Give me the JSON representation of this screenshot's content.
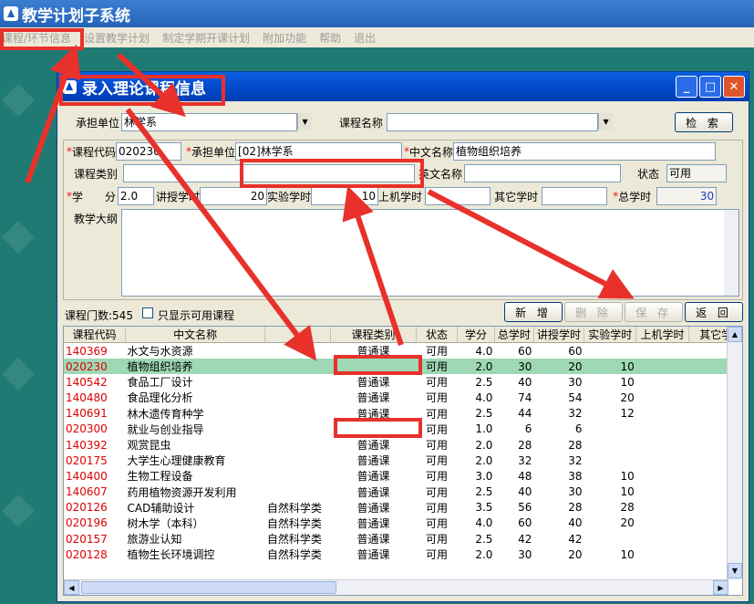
{
  "app": {
    "title": "教学计划子系统"
  },
  "menu": [
    "课程/环节信息",
    "设置教学计划",
    "制定学期开课计划",
    "附加功能",
    "帮助",
    "退出"
  ],
  "dialog": {
    "title": "录入理论课程信息",
    "controls": {
      "minimize": "_",
      "maximize": "□",
      "close": "✕"
    }
  },
  "search": {
    "dept_label": "承担单位",
    "dept_value": "林学系",
    "course_label": "课程名称",
    "course_value": "",
    "search_button": "检 索"
  },
  "form": {
    "code_label": "课程代码",
    "code_value": "020230",
    "dept_label": "承担单位",
    "dept_value": "[02]林学系",
    "cname_label": "中文名称",
    "cname_value": "植物组织培养",
    "type_label": "课程类别",
    "type_value": "",
    "ename_label": "英文名称",
    "ename_value": "",
    "status_label": "状态",
    "status_value": "可用",
    "credit_label": "学　　分",
    "credit_value": "2.0",
    "lecture_label": "讲授学时",
    "lecture_value": "20",
    "lab_label": "实验学时",
    "lab_value": "10",
    "computer_label": "上机学时",
    "computer_value": "",
    "other_label": "其它学时",
    "other_value": "",
    "total_label": "总学时",
    "total_value": "30",
    "syllabus_label": "教学大纲",
    "syllabus_value": ""
  },
  "list_bar": {
    "count_text": "课程门数:545",
    "available_only": "只显示可用课程",
    "buttons": {
      "new": "新 增",
      "delete": "删 除",
      "save": "保 存",
      "back": "返 回"
    }
  },
  "table": {
    "columns": [
      "课程代码",
      "中文名称",
      "",
      "课程类别",
      "状态",
      "学分",
      "总学时",
      "讲授学时",
      "实验学时",
      "上机学时",
      "其它学"
    ],
    "rows": [
      [
        "140369",
        "水文与水资源",
        "",
        "普通课",
        "可用",
        "4.0",
        "60",
        "60",
        "",
        "",
        ""
      ],
      [
        "020230",
        "植物组织培养",
        "",
        "",
        "可用",
        "2.0",
        "30",
        "20",
        "10",
        "",
        ""
      ],
      [
        "140542",
        "食品工厂设计",
        "",
        "普通课",
        "可用",
        "2.5",
        "40",
        "30",
        "10",
        "",
        ""
      ],
      [
        "140480",
        "食品理化分析",
        "",
        "普通课",
        "可用",
        "4.0",
        "74",
        "54",
        "20",
        "",
        ""
      ],
      [
        "140691",
        "林木遗传育种学",
        "",
        "普通课",
        "可用",
        "2.5",
        "44",
        "32",
        "12",
        "",
        ""
      ],
      [
        "020300",
        "就业与创业指导",
        "",
        "",
        "可用",
        "1.0",
        "6",
        "6",
        "",
        "",
        ""
      ],
      [
        "140392",
        "观赏昆虫",
        "",
        "普通课",
        "可用",
        "2.0",
        "28",
        "28",
        "",
        "",
        ""
      ],
      [
        "020175",
        "大学生心理健康教育",
        "",
        "普通课",
        "可用",
        "2.0",
        "32",
        "32",
        "",
        "",
        ""
      ],
      [
        "140400",
        "生物工程设备",
        "",
        "普通课",
        "可用",
        "3.0",
        "48",
        "38",
        "10",
        "",
        ""
      ],
      [
        "140607",
        "药用植物资源开发利用",
        "",
        "普通课",
        "可用",
        "2.5",
        "40",
        "30",
        "10",
        "",
        ""
      ],
      [
        "020126",
        "CAD辅助设计",
        "自然科学类",
        "普通课",
        "可用",
        "3.5",
        "56",
        "28",
        "28",
        "",
        ""
      ],
      [
        "020196",
        "树木学（本科）",
        "自然科学类",
        "普通课",
        "可用",
        "4.0",
        "60",
        "40",
        "20",
        "",
        ""
      ],
      [
        "020157",
        "旅游业认知",
        "自然科学类",
        "普通课",
        "可用",
        "2.5",
        "42",
        "42",
        "",
        "",
        ""
      ],
      [
        "020128",
        "植物生长环境调控",
        "自然科学类",
        "普通课",
        "可用",
        "2.0",
        "30",
        "20",
        "10",
        "",
        ""
      ]
    ],
    "selected_row": 1
  },
  "colors": {
    "accent_red": "#e8312b",
    "selected_row": "#9ed8b4",
    "desktop": "#1f7a73"
  }
}
